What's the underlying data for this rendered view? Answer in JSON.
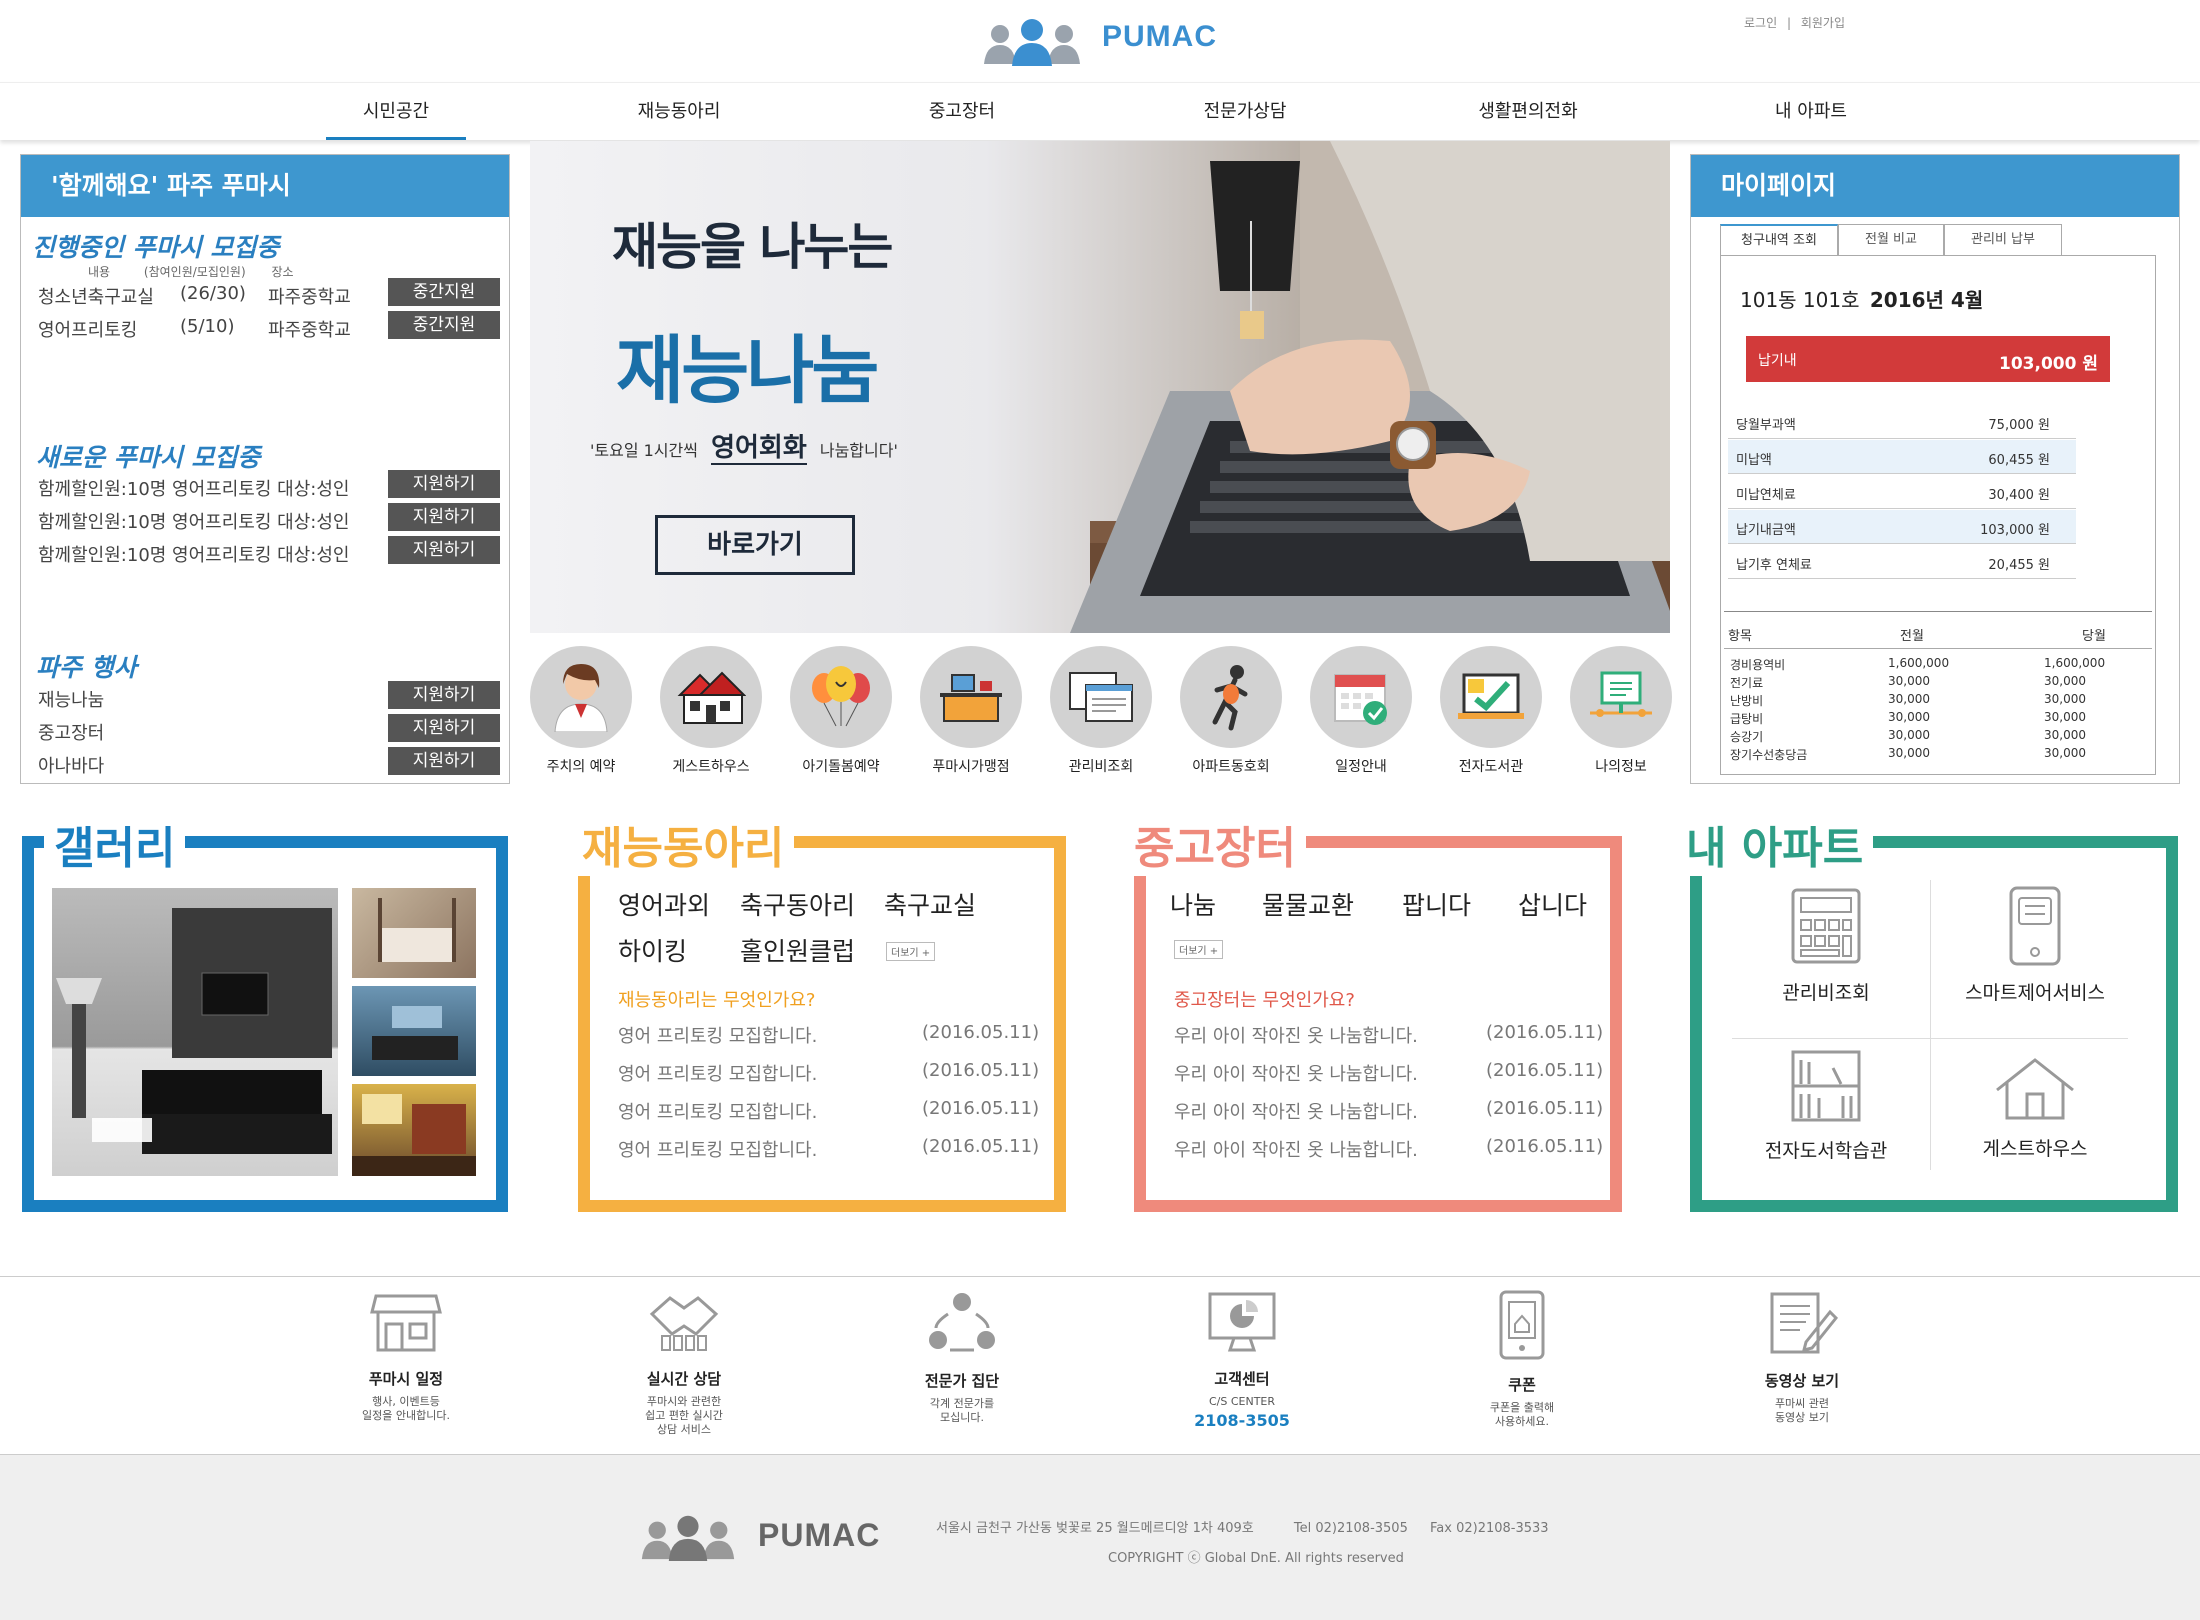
{
  "header": {
    "brand": "PUMAC",
    "login": "로그인",
    "signup": "회원가입",
    "sep": "|"
  },
  "nav": [
    "시민공간",
    "재능동아리",
    "중고장터",
    "전문가상담",
    "생활편의전화",
    "내 아파트"
  ],
  "left_panel": {
    "title": "'함께해요' 파주 푸마시",
    "sec1": {
      "title": "진행중인 푸마시 모집중",
      "headers": [
        "내용",
        "(참여인원/모집인원)",
        "장소"
      ],
      "rows": [
        {
          "name": "청소년축구교실",
          "count": "(26/30)",
          "place": "파주중학교",
          "btn": "중간지원"
        },
        {
          "name": "영어프리토킹",
          "count": "(5/10)",
          "place": "파주중학교",
          "btn": "중간지원"
        }
      ]
    },
    "sec2": {
      "title": "새로운 푸마시 모집중",
      "rows": [
        {
          "text": "함께할인원:10명 영어프리토킹 대상:성인",
          "btn": "지원하기"
        },
        {
          "text": "함께할인원:10명 영어프리토킹 대상:성인",
          "btn": "지원하기"
        },
        {
          "text": "함께할인원:10명 영어프리토킹 대상:성인",
          "btn": "지원하기"
        }
      ]
    },
    "sec3": {
      "title": "파주 행사",
      "rows": [
        {
          "text": "재능나눔",
          "btn": "지원하기"
        },
        {
          "text": "중고장터",
          "btn": "지원하기"
        },
        {
          "text": "아나바다",
          "btn": "지원하기"
        }
      ]
    }
  },
  "banner": {
    "line1": "재능을 나누는",
    "line2": "재능나눔",
    "sub_pre": "'토요일 1시간씩",
    "sub_em": "영어회화",
    "sub_post": "나눔합니다'",
    "cta": "바로가기"
  },
  "quick_icons": [
    "주치의 예약",
    "게스트하우스",
    "아기돌봄예약",
    "푸마시가맹점",
    "관리비조회",
    "아파트동호회",
    "일정안내",
    "전자도서관",
    "나의정보"
  ],
  "mypage": {
    "title": "마이페이지",
    "tabs": [
      "청구내역 조회",
      "전월 비교",
      "관리비 납부"
    ],
    "unit": "101동 101호",
    "period": "2016년 4월",
    "due_label": "납기내",
    "due_amount": "103,000 원",
    "rows": [
      {
        "label": "당월부과액",
        "value": "75,000 원"
      },
      {
        "label": "미납액",
        "value": "60,455 원"
      },
      {
        "label": "미납연체료",
        "value": "30,400 원"
      },
      {
        "label": "납기내금액",
        "value": "103,000 원"
      },
      {
        "label": "납기후 연체료",
        "value": "20,455 원"
      }
    ],
    "compare_headers": [
      "항목",
      "전월",
      "당월"
    ],
    "compare": [
      [
        "경비용역비",
        "1,600,000",
        "1,600,000"
      ],
      [
        "전기료",
        "30,000",
        "30,000"
      ],
      [
        "난방비",
        "30,000",
        "30,000"
      ],
      [
        "급탕비",
        "30,000",
        "30,000"
      ],
      [
        "승강기",
        "30,000",
        "30,000"
      ],
      [
        "장기수선충당금",
        "30,000",
        "30,000"
      ]
    ]
  },
  "gallery": {
    "title": "갤러리"
  },
  "club": {
    "title": "재능동아리",
    "tags": [
      "영어과외",
      "축구동아리",
      "축구교실",
      "하이킹",
      "홀인원클럽"
    ],
    "more": "더보기 +",
    "question": "재능동아리는 무엇인가요?",
    "items": [
      {
        "text": "영어 프리토킹 모집합니다.",
        "date": "(2016.05.11)"
      },
      {
        "text": "영어 프리토킹 모집합니다.",
        "date": "(2016.05.11)"
      },
      {
        "text": "영어 프리토킹 모집합니다.",
        "date": "(2016.05.11)"
      },
      {
        "text": "영어 프리토킹 모집합니다.",
        "date": "(2016.05.11)"
      }
    ]
  },
  "market": {
    "title": "중고장터",
    "tags": [
      "나눔",
      "물물교환",
      "팝니다",
      "삽니다"
    ],
    "more": "더보기 +",
    "question": "중고장터는 무엇인가요?",
    "items": [
      {
        "text": "우리 아이 작아진 옷 나눔합니다.",
        "date": "(2016.05.11)"
      },
      {
        "text": "우리 아이 작아진 옷 나눔합니다.",
        "date": "(2016.05.11)"
      },
      {
        "text": "우리 아이 작아진 옷 나눔합니다.",
        "date": "(2016.05.11)"
      },
      {
        "text": "우리 아이 작아진 옷 나눔합니다.",
        "date": "(2016.05.11)"
      }
    ]
  },
  "apt": {
    "title": "내 아파트",
    "items": [
      "관리비조회",
      "스마트제어서비스",
      "전자도서학습관",
      "게스트하우스"
    ]
  },
  "services": [
    {
      "title": "푸마시 일정",
      "desc": "행사, 이벤트등\n일정을 안내합니다."
    },
    {
      "title": "실시간 상담",
      "desc": "푸마시와 관련한\n쉽고 편한 실시간\n상담 서비스"
    },
    {
      "title": "전문가 집단",
      "desc": "각계 전문가를\n모십니다."
    },
    {
      "title": "고객센터",
      "desc": "C/S CENTER",
      "phone": "2108-3505"
    },
    {
      "title": "쿠폰",
      "desc": "쿠폰을 출력해\n사용하세요."
    },
    {
      "title": "동영상 보기",
      "desc": "푸마씨 관련\n동영상 보기"
    }
  ],
  "footer": {
    "brand": "PUMAC",
    "address": "서울시 금천구 가산동 벚꽃로 25 월드메르디앙 1차  409호",
    "tel": "Tel 02)2108-3505",
    "fax": "Fax 02)2108-3533",
    "copyright": "COPYRIGHT ⓒ Global DnE. All rights reserved"
  },
  "colors": {
    "blue": "#1a7fc0",
    "orange": "#f5b041",
    "salmon": "#ef8a7c",
    "teal": "#2e9e86",
    "red": "#d23a3a"
  }
}
